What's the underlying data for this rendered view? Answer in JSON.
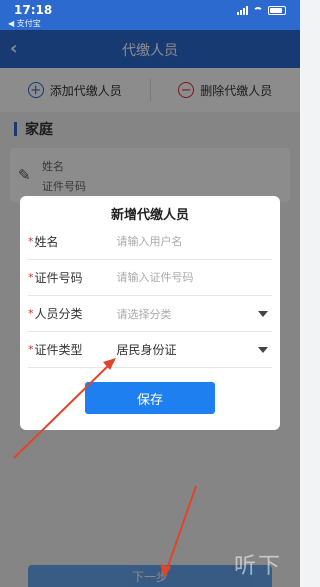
{
  "status_bar": {
    "time": "17:18",
    "back_app": "◀ 支付宝"
  },
  "navbar": {
    "back_icon": "‹",
    "title": "代缴人员"
  },
  "actions": {
    "add": {
      "icon": "+",
      "label": "添加代缴人员"
    },
    "remove": {
      "icon": "−",
      "label": "删除代缴人员"
    }
  },
  "section": {
    "label": "家庭"
  },
  "member_card": {
    "name_label": "姓名",
    "id_label": "证件号码"
  },
  "dialog": {
    "title": "新增代缴人员",
    "rows": [
      {
        "required": "*",
        "label": "姓名",
        "placeholder": "请输入用户名"
      },
      {
        "required": "*",
        "label": "证件号码",
        "placeholder": "请输入证件号码"
      },
      {
        "required": "*",
        "label": "人员分类",
        "placeholder": "请选择分类"
      },
      {
        "required": "*",
        "label": "证件类型",
        "value": "居民身份证"
      }
    ],
    "save_label": "保存"
  },
  "bottom": {
    "next_label": "下一步",
    "watermark": "听下"
  },
  "colors": {
    "primary": "#2c6ad0",
    "button": "#1e7ff0",
    "danger": "#d93030",
    "annotation": "#e0452b"
  }
}
